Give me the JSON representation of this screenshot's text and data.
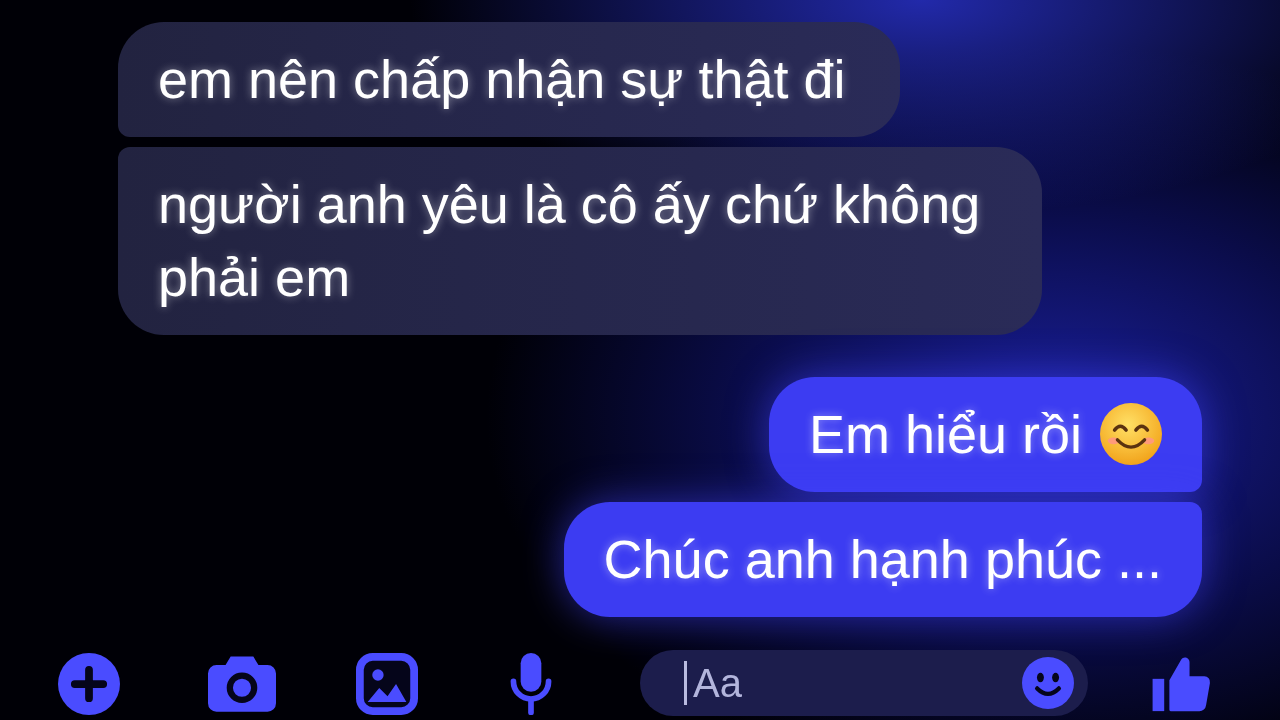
{
  "messages": [
    {
      "kind": "received",
      "text": "em nên chấp nhận sự thật đi",
      "emoji": false
    },
    {
      "kind": "received",
      "text": "người anh yêu là cô ấy chứ không phải em",
      "emoji": false
    },
    {
      "kind": "sent",
      "text": "Em hiểu rồi",
      "emoji": true
    },
    {
      "kind": "sent",
      "text": "Chúc anh hạnh phúc ...",
      "emoji": false
    }
  ],
  "composer": {
    "placeholder": "Aa"
  }
}
